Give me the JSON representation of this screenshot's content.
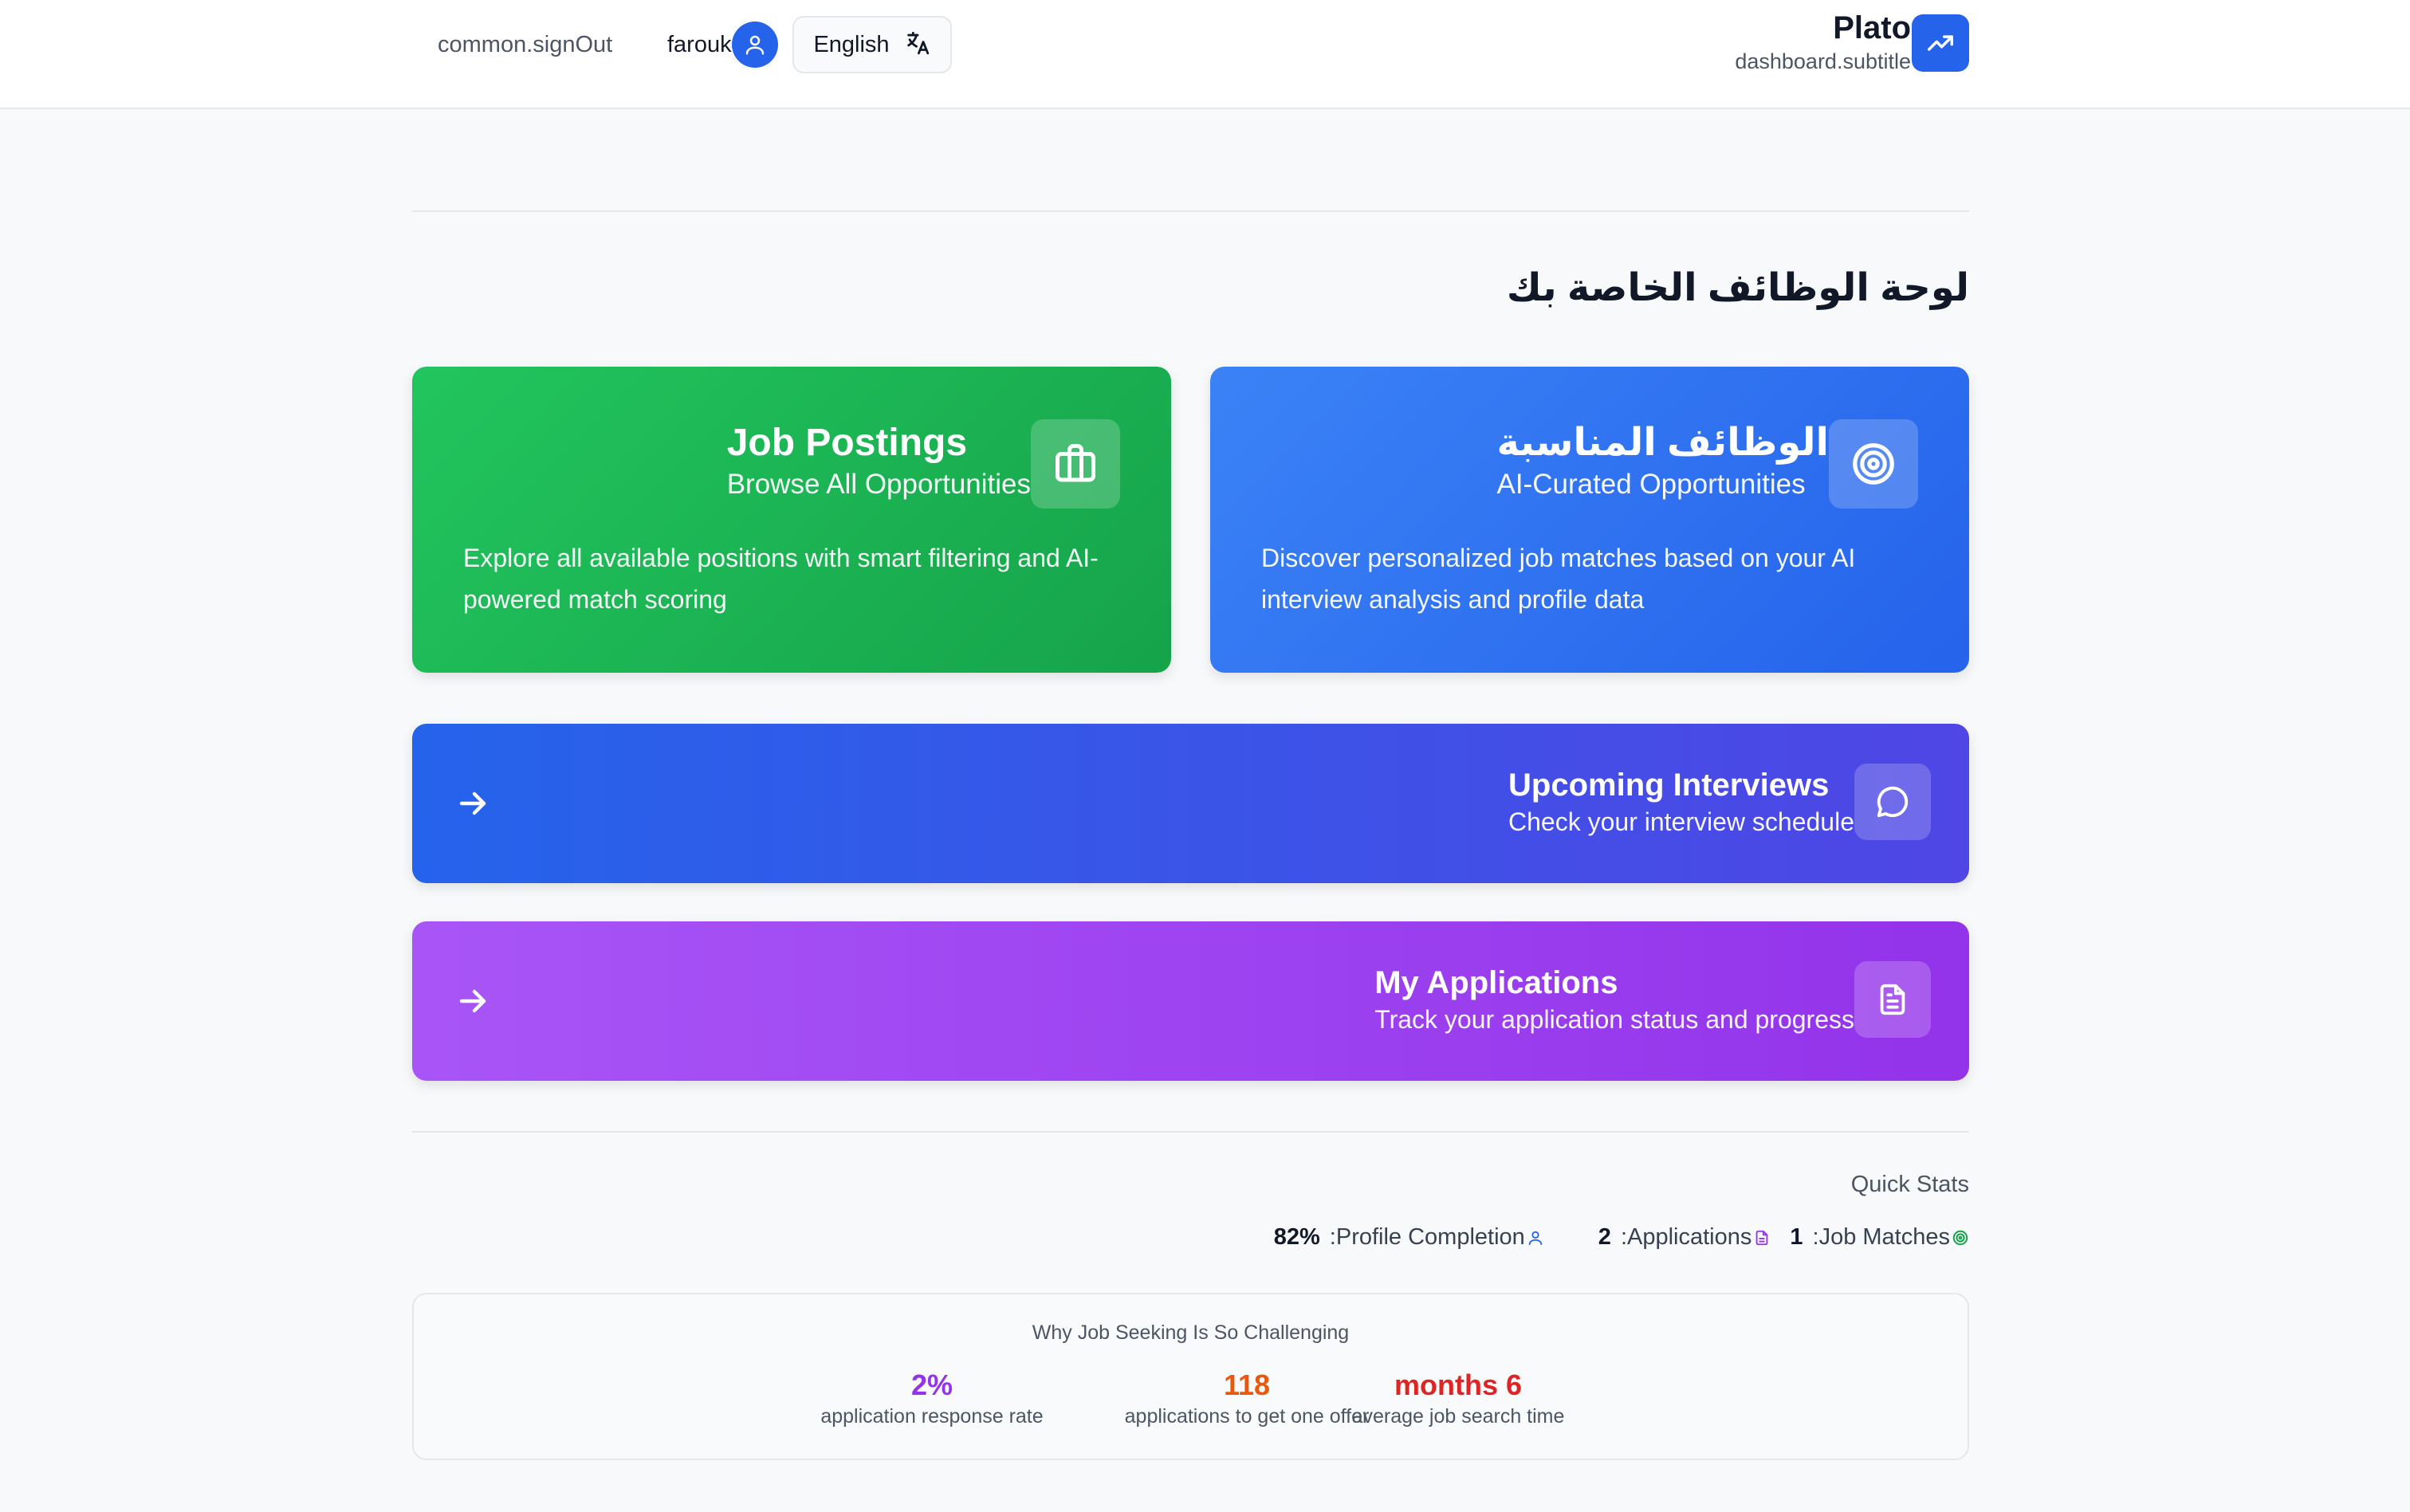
{
  "header": {
    "signout_label": "common.signOut",
    "user_name": "farouk",
    "language_label": "English",
    "brand_title": "Plato",
    "brand_subtitle": "dashboard.subtitle",
    "accent_color": "#2563eb"
  },
  "page": {
    "title": "لوحة الوظائف الخاصة بك"
  },
  "cards": {
    "job_postings": {
      "title": "Job Postings",
      "subtitle": "Browse All Opportunities",
      "description": "Explore all available positions with smart filtering and AI-powered match scoring",
      "icon": "briefcase-icon",
      "color": "#22c55e"
    },
    "matched_jobs": {
      "title": "الوظائف المناسبة",
      "subtitle": "AI-Curated Opportunities",
      "description": "Discover personalized job matches based on your AI interview analysis and profile data",
      "icon": "target-icon",
      "color": "#3b82f6"
    },
    "interviews": {
      "title": "Upcoming Interviews",
      "subtitle": "Check your interview schedule",
      "icon": "chat-bubble-icon",
      "color": "#4f46e5"
    },
    "applications": {
      "title": "My Applications",
      "subtitle": "Track your application status and progress",
      "icon": "document-icon",
      "color": "#9333ea"
    }
  },
  "quick_stats": {
    "title": "Quick Stats",
    "profile_completion": {
      "label": ":Profile Completion",
      "value": "82%"
    },
    "applications": {
      "label": ":Applications",
      "value": "2"
    },
    "job_matches": {
      "label": ":Job Matches",
      "value": "1"
    }
  },
  "challenge": {
    "title": "Why Job Seeking Is So Challenging",
    "facts": [
      {
        "value": "2%",
        "label": "application response rate",
        "color": "#9333ea"
      },
      {
        "value": "118",
        "label": "applications to get one offer",
        "color": "#ea580c"
      },
      {
        "value": "months 6",
        "label": "average job search time",
        "color": "#dc2626"
      }
    ]
  }
}
